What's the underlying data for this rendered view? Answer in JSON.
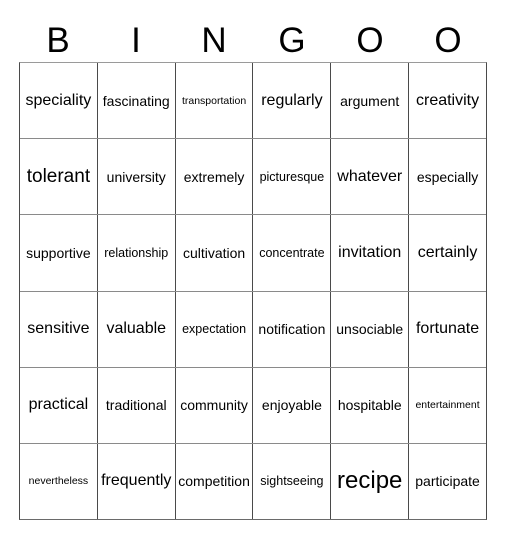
{
  "card": {
    "header_letters": [
      "B",
      "I",
      "N",
      "G",
      "O",
      "O"
    ],
    "columns": 6,
    "rows": 6,
    "text_color": "#000000",
    "background_color": "#ffffff",
    "border_color": "#4a4a4a",
    "cells": [
      [
        {
          "label": "speciality",
          "size": "fs-l"
        },
        {
          "label": "fascinating",
          "size": "fs-m"
        },
        {
          "label": "transportation",
          "size": "fs-xs"
        },
        {
          "label": "regularly",
          "size": "fs-l"
        },
        {
          "label": "argument",
          "size": "fs-m"
        },
        {
          "label": "creativity",
          "size": "fs-l"
        }
      ],
      [
        {
          "label": "tolerant",
          "size": "fs-xl"
        },
        {
          "label": "university",
          "size": "fs-m"
        },
        {
          "label": "extremely",
          "size": "fs-m"
        },
        {
          "label": "picturesque",
          "size": "fs-s"
        },
        {
          "label": "whatever",
          "size": "fs-l"
        },
        {
          "label": "especially",
          "size": "fs-m"
        }
      ],
      [
        {
          "label": "supportive",
          "size": "fs-m"
        },
        {
          "label": "relationship",
          "size": "fs-s"
        },
        {
          "label": "cultivation",
          "size": "fs-m"
        },
        {
          "label": "concentrate",
          "size": "fs-s"
        },
        {
          "label": "invitation",
          "size": "fs-l"
        },
        {
          "label": "certainly",
          "size": "fs-l"
        }
      ],
      [
        {
          "label": "sensitive",
          "size": "fs-l"
        },
        {
          "label": "valuable",
          "size": "fs-l"
        },
        {
          "label": "expectation",
          "size": "fs-s"
        },
        {
          "label": "notification",
          "size": "fs-m"
        },
        {
          "label": "unsociable",
          "size": "fs-m"
        },
        {
          "label": "fortunate",
          "size": "fs-l"
        }
      ],
      [
        {
          "label": "practical",
          "size": "fs-l"
        },
        {
          "label": "traditional",
          "size": "fs-m"
        },
        {
          "label": "community",
          "size": "fs-m"
        },
        {
          "label": "enjoyable",
          "size": "fs-m"
        },
        {
          "label": "hospitable",
          "size": "fs-m"
        },
        {
          "label": "entertainment",
          "size": "fs-xs"
        }
      ],
      [
        {
          "label": "nevertheless",
          "size": "fs-xs"
        },
        {
          "label": "frequently",
          "size": "fs-l"
        },
        {
          "label": "competition",
          "size": "fs-m"
        },
        {
          "label": "sightseeing",
          "size": "fs-s"
        },
        {
          "label": "recipe",
          "size": "fs-xxl"
        },
        {
          "label": "participate",
          "size": "fs-m"
        }
      ]
    ]
  }
}
